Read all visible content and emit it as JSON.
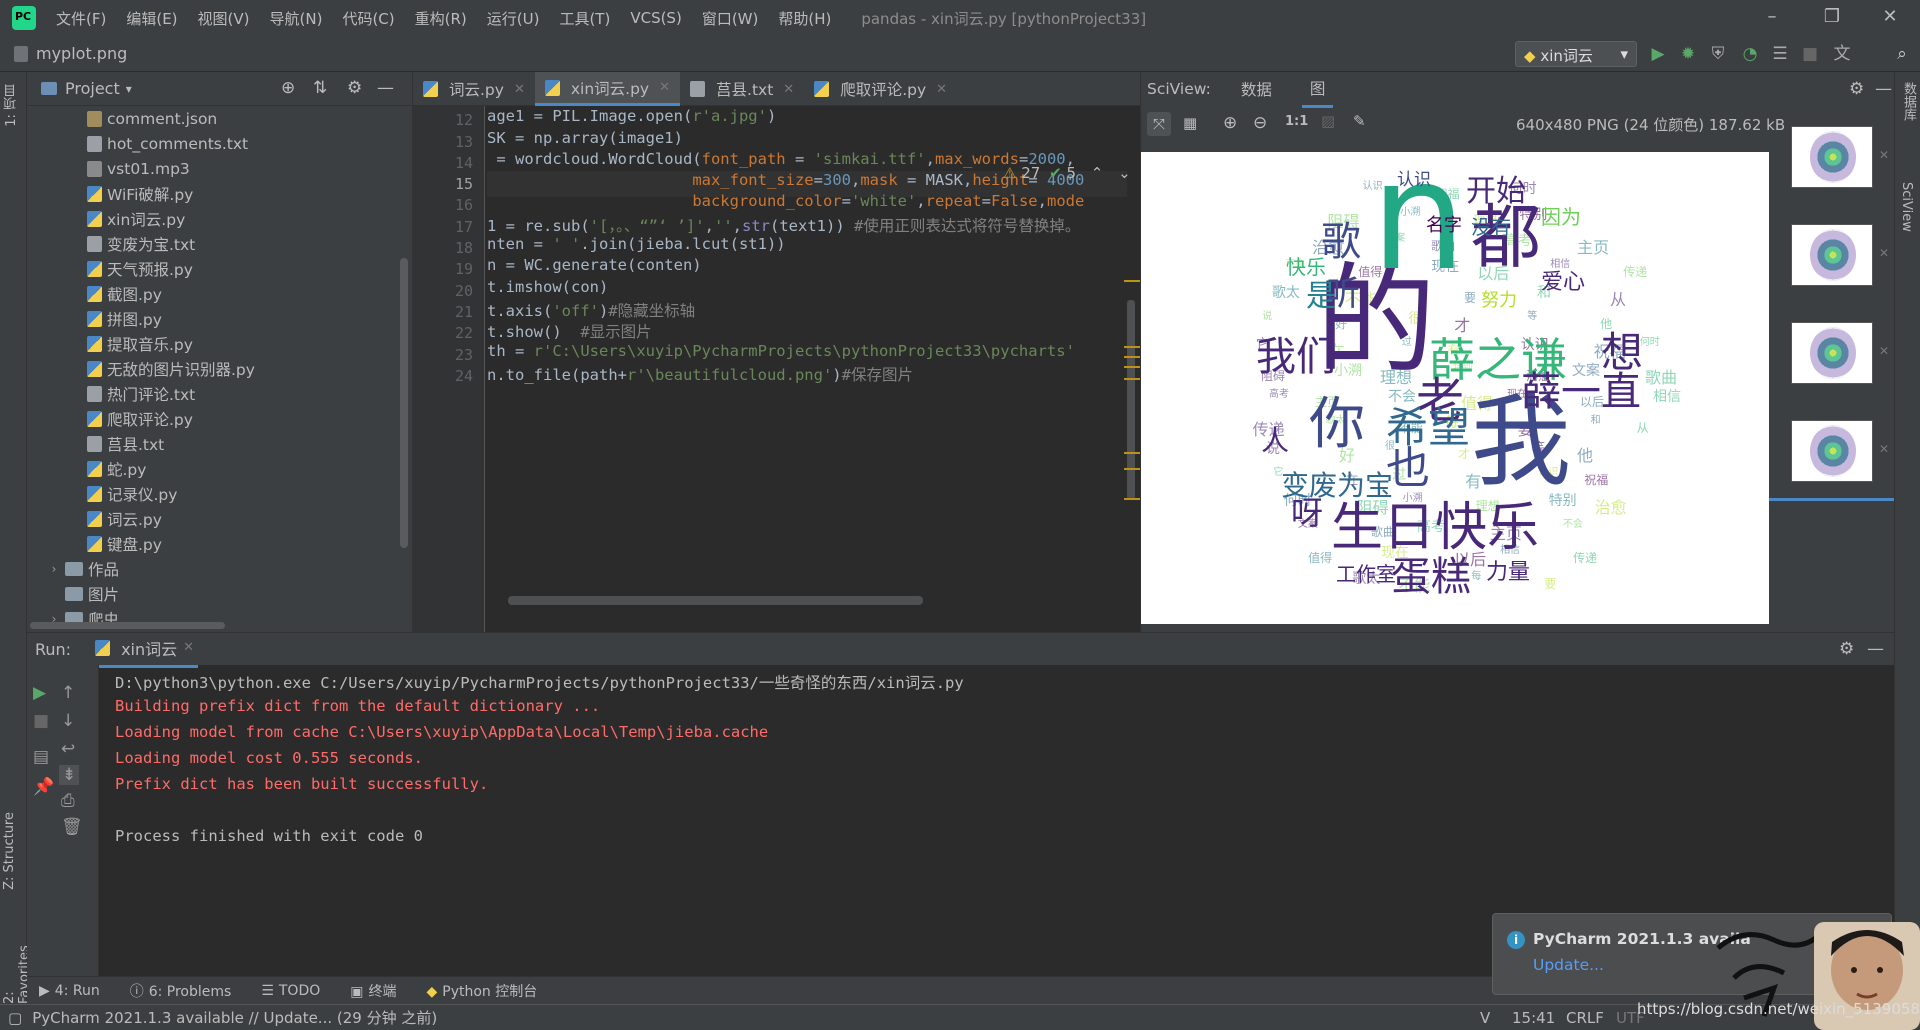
{
  "menubar": {
    "items": [
      "文件(F)",
      "编辑(E)",
      "视图(V)",
      "导航(N)",
      "代码(C)",
      "重构(R)",
      "运行(U)",
      "工具(T)",
      "VCS(S)",
      "窗口(W)",
      "帮助(H)"
    ],
    "title": "pandas - xin词云.py [pythonProject33]"
  },
  "navbar": {
    "file": "myplot.png",
    "run_config": "xin词云"
  },
  "project": {
    "header": "Project",
    "files": [
      {
        "name": "comment.json",
        "type": "json"
      },
      {
        "name": "hot_comments.txt",
        "type": "txt"
      },
      {
        "name": "vst01.mp3",
        "type": "mp3"
      },
      {
        "name": "WiFi破解.py",
        "type": "py"
      },
      {
        "name": "xin词云.py",
        "type": "py"
      },
      {
        "name": "变废为宝.txt",
        "type": "txt"
      },
      {
        "name": "天气预报.py",
        "type": "py"
      },
      {
        "name": "截图.py",
        "type": "py"
      },
      {
        "name": "拼图.py",
        "type": "py"
      },
      {
        "name": "提取音乐.py",
        "type": "py"
      },
      {
        "name": "无敌的图片识别器.py",
        "type": "py"
      },
      {
        "name": "热门评论.txt",
        "type": "txt"
      },
      {
        "name": "爬取评论.py",
        "type": "py"
      },
      {
        "name": "莒县.txt",
        "type": "txt"
      },
      {
        "name": "蛇.py",
        "type": "py"
      },
      {
        "name": "记录仪.py",
        "type": "py"
      },
      {
        "name": "词云.py",
        "type": "py"
      },
      {
        "name": "键盘.py",
        "type": "py"
      }
    ],
    "folders": [
      "作品",
      "图片",
      "爬虫"
    ]
  },
  "editor": {
    "tabs": [
      "词云.py",
      "xin词云.py",
      "莒县.txt",
      "爬取评论.py"
    ],
    "active_tab": 1,
    "inspection": {
      "warnings": "27",
      "typos": "5"
    },
    "line_numbers": [
      "12",
      "13",
      "14",
      "15",
      "16",
      "17",
      "18",
      "19",
      "20",
      "21",
      "22",
      "23",
      "24"
    ],
    "current_line": "15"
  },
  "sciview": {
    "title": "SciView:",
    "tabs": [
      "数据",
      "图"
    ],
    "image_info": "640x480 PNG (24 位颜色) 187.62 kB"
  },
  "wordcloud": {
    "words": [
      {
        "t": "的",
        "c": "#482878"
      },
      {
        "t": "n",
        "c": "#22a884"
      },
      {
        "t": "我",
        "c": "#3e4a89"
      },
      {
        "t": "都",
        "c": "#482878"
      },
      {
        "t": "生日快乐",
        "c": "#482878"
      },
      {
        "t": "薛之谦",
        "c": "#35b779"
      },
      {
        "t": "你",
        "c": "#3e4a89"
      },
      {
        "t": "老",
        "c": "#482878"
      },
      {
        "t": "希望",
        "c": "#31688e"
      },
      {
        "t": "蛋糕",
        "c": "#482878"
      },
      {
        "t": "开始",
        "c": "#482878"
      },
      {
        "t": "歌",
        "c": "#3e4a89"
      },
      {
        "t": "听",
        "c": "#3e4a89"
      },
      {
        "t": "是",
        "c": "#26828e"
      },
      {
        "t": "也",
        "c": "#3e4a89"
      },
      {
        "t": "薛一直",
        "c": "#482878"
      },
      {
        "t": "想",
        "c": "#482878"
      },
      {
        "t": "变废为宝",
        "c": "#31688e"
      },
      {
        "t": "呀",
        "c": "#482878"
      },
      {
        "t": "工作室",
        "c": "#482878"
      },
      {
        "t": "力量",
        "c": "#482878"
      },
      {
        "t": "人",
        "c": "#482878"
      },
      {
        "t": "我们",
        "c": "#482878"
      },
      {
        "t": "没有",
        "c": "#31688e"
      },
      {
        "t": "因为",
        "c": "#6ece58"
      },
      {
        "t": "爱心",
        "c": "#482878"
      },
      {
        "t": "努力",
        "c": "#b5de2b"
      },
      {
        "t": "快乐",
        "c": "#35b779"
      },
      {
        "t": "名字",
        "c": "#440154"
      },
      {
        "t": "认识",
        "c": "#3e4a89"
      }
    ]
  },
  "run": {
    "label": "Run:",
    "tab": "xin词云",
    "console": [
      {
        "text": "D:\\python3\\python.exe C:/Users/xuyip/PycharmProjects/pythonProject33/一些奇怪的东西/xin词云.py",
        "color": "#bbbbbb"
      },
      {
        "text": "Building prefix dict from the default dictionary ...",
        "color": "#ff6b68"
      },
      {
        "text": "Loading model from cache C:\\Users\\xuyip\\AppData\\Local\\Temp\\jieba.cache",
        "color": "#ff6b68"
      },
      {
        "text": "Loading model cost 0.555 seconds.",
        "color": "#ff6b68"
      },
      {
        "text": "Prefix dict has been built successfully.",
        "color": "#ff6b68"
      },
      {
        "text": "",
        "color": "#bbbbbb"
      },
      {
        "text": "Process finished with exit code 0",
        "color": "#bbbbbb"
      }
    ]
  },
  "bottom_tabs": [
    "4: Run",
    "6: Problems",
    "TODO",
    "终端",
    "Python 控制台"
  ],
  "sidebar_tabs": {
    "project": "1: 项目",
    "structure": "Z: Structure",
    "favorites": "2: Favorites",
    "data": "数据库",
    "sciview": "SciView"
  },
  "statusbar": {
    "message": "PyCharm 2021.1.3 available // Update... (29 分钟 之前)",
    "time": "15:41",
    "eol": "CRLF",
    "encoding": "UTF"
  },
  "notification": {
    "title": "PyCharm 2021.1.3 availa",
    "action": "Update..."
  },
  "watermark": "https://blog.csdn.net/weixin_51390582"
}
